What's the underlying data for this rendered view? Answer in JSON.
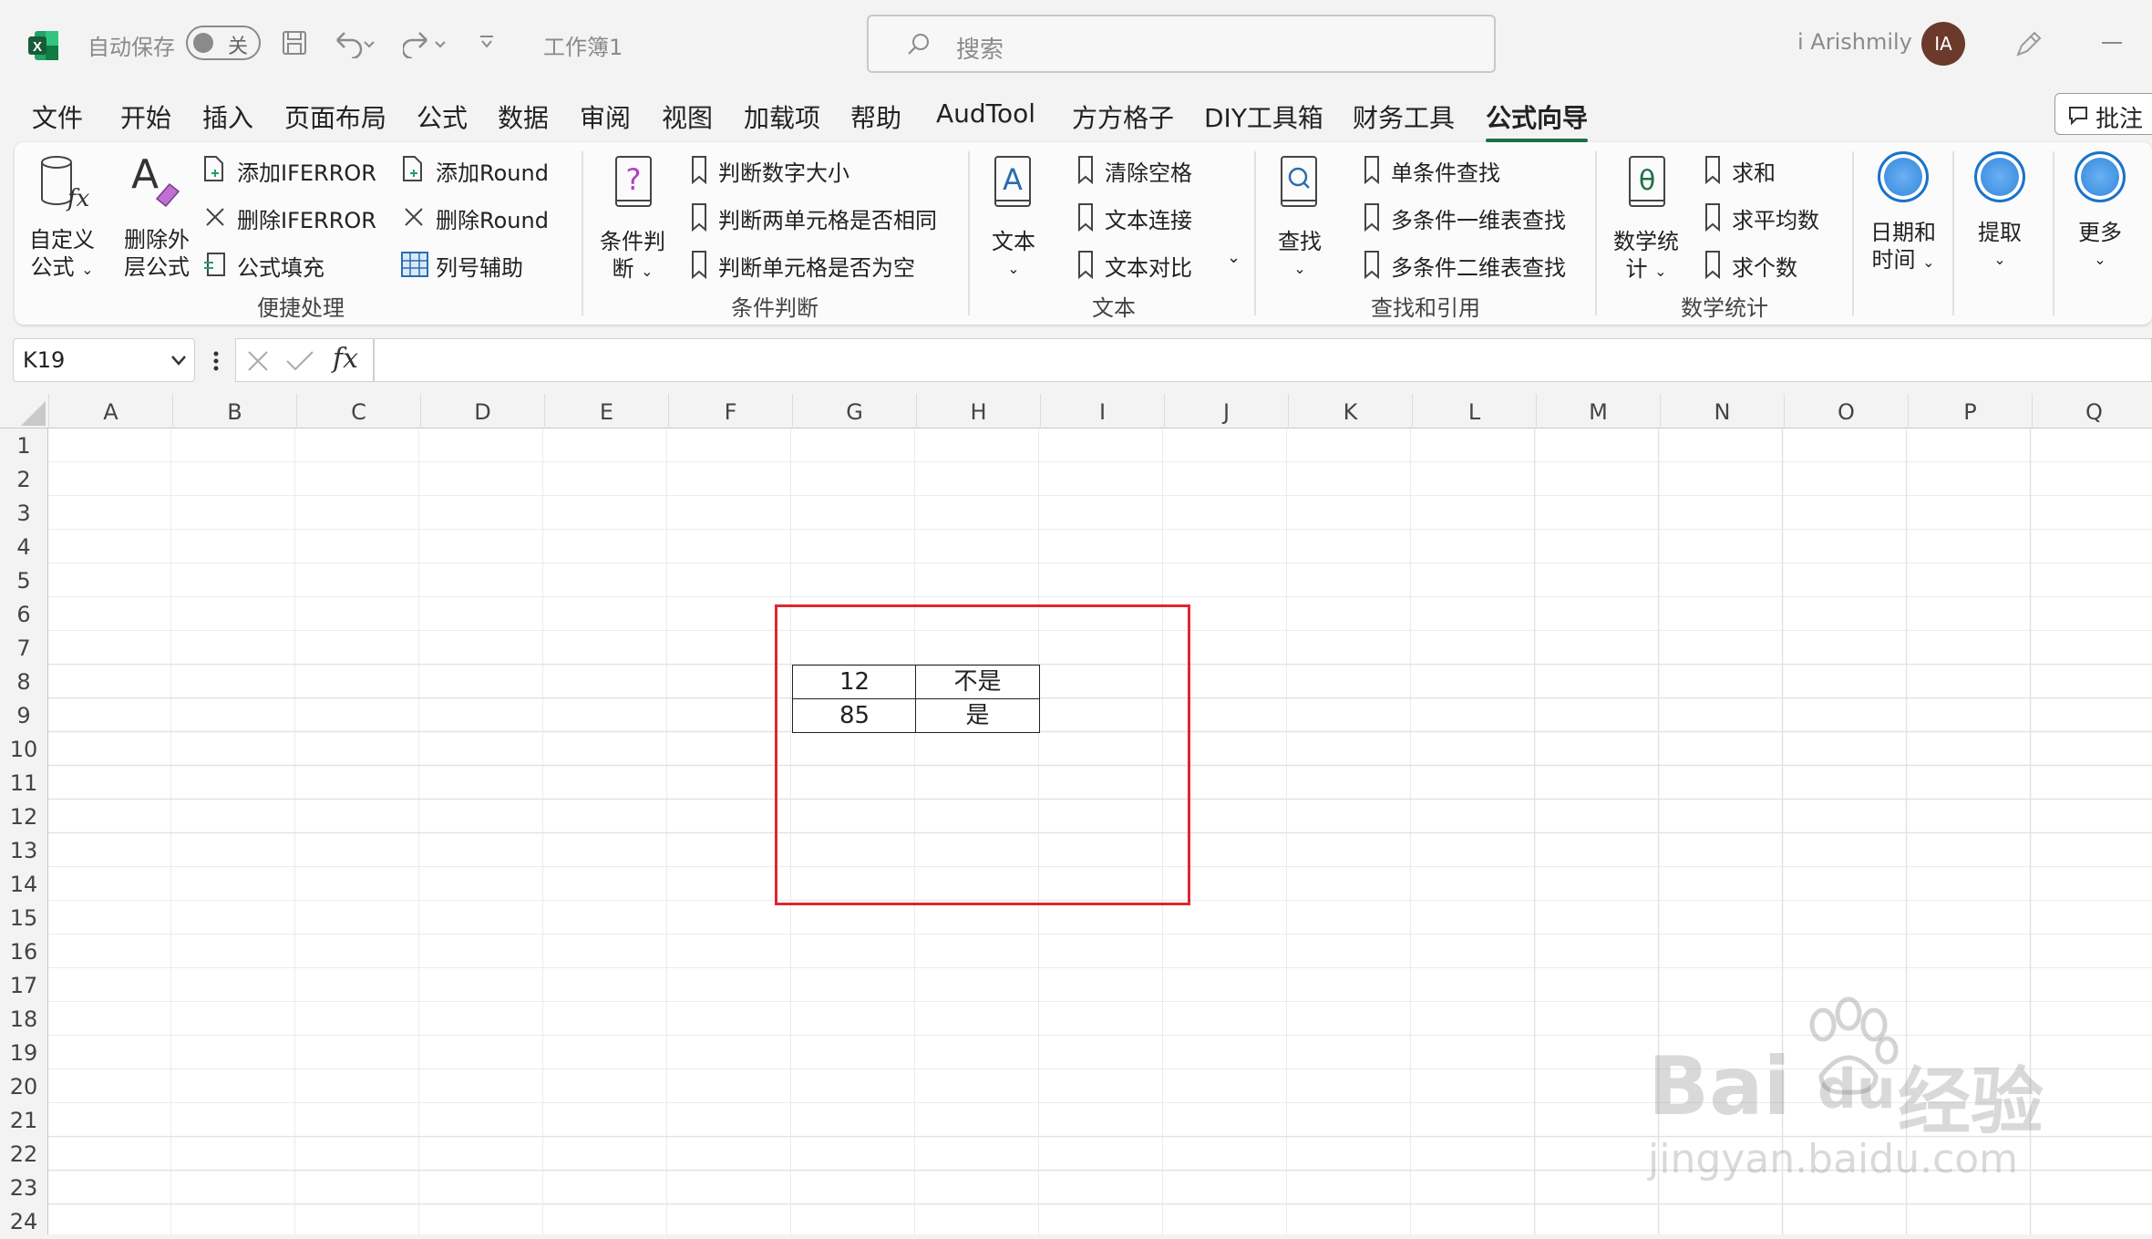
{
  "titlebar": {
    "autosave_label": "自动保存",
    "autosave_toggle": "关",
    "doc_title": "工作簿1",
    "search_placeholder": "搜索",
    "user_name": "i Arishmily",
    "avatar_initials": "IA"
  },
  "menu": {
    "tabs": [
      "文件",
      "开始",
      "插入",
      "页面布局",
      "公式",
      "数据",
      "审阅",
      "视图",
      "加载项",
      "帮助",
      "AudTool",
      "方方格子",
      "DIY工具箱",
      "财务工具",
      "公式向导"
    ],
    "active_tab": "公式向导",
    "comment_button": "批注"
  },
  "ribbon": {
    "groups": {
      "quick": {
        "label": "便捷处理",
        "custom_formula": [
          "自定义",
          "公式"
        ],
        "delete_outer": [
          "删除外",
          "层公式"
        ],
        "add_iferror": "添加IFERROR",
        "del_iferror": "删除IFERROR",
        "formula_fill": "公式填充",
        "add_round": "添加Round",
        "del_round": "删除Round",
        "col_helper": "列号辅助"
      },
      "condition": {
        "label": "条件判断",
        "big": [
          "条件判",
          "断"
        ],
        "item1": "判断数字大小",
        "item2": "判断两单元格是否相同",
        "item3": "判断单元格是否为空"
      },
      "text": {
        "label": "文本",
        "big": "文本",
        "item1": "清除空格",
        "item2": "文本连接",
        "item3": "文本对比"
      },
      "lookup": {
        "label": "查找和引用",
        "big": "查找",
        "item1": "单条件查找",
        "item2": "多条件一维表查找",
        "item3": "多条件二维表查找"
      },
      "math": {
        "label": "数学统计",
        "big": [
          "数学统",
          "计"
        ],
        "item1": "求和",
        "item2": "求平均数",
        "item3": "求个数"
      },
      "extra": {
        "datetime": [
          "日期和",
          "时间"
        ],
        "extract": "提取",
        "more": "更多"
      }
    }
  },
  "formula_bar": {
    "name_box": "K19",
    "fx": "fx",
    "value": ""
  },
  "sheet": {
    "columns": [
      "A",
      "B",
      "C",
      "D",
      "E",
      "F",
      "G",
      "H",
      "I",
      "J",
      "K",
      "L",
      "M",
      "N",
      "O",
      "P",
      "Q"
    ],
    "rows": [
      "1",
      "2",
      "3",
      "4",
      "5",
      "6",
      "7",
      "8",
      "9",
      "10",
      "11",
      "12",
      "13",
      "14",
      "15",
      "16",
      "17",
      "18",
      "19",
      "20",
      "21",
      "22",
      "23",
      "24"
    ],
    "cells": {
      "G8": "12",
      "H8": "不是",
      "G9": "85",
      "H9": "是"
    },
    "highlight_color": "#e0262f"
  },
  "watermark": {
    "brand": "Bai",
    "paw": "du",
    "cn": "经验",
    "url": "jingyan.baidu.com"
  }
}
